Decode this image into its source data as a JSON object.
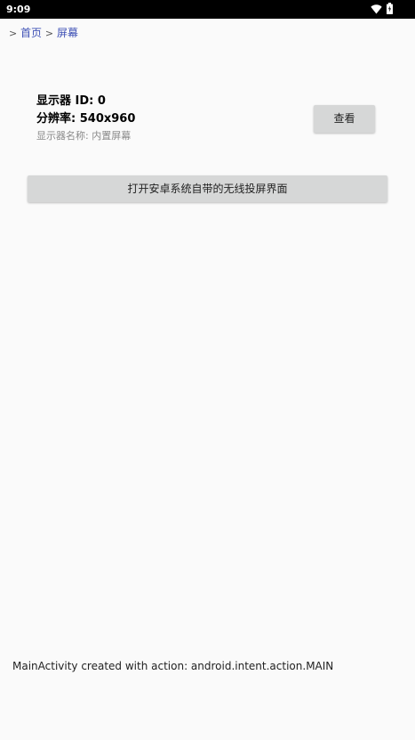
{
  "status_bar": {
    "time": "9:09",
    "icons": [
      "wifi-icon",
      "battery-icon"
    ]
  },
  "breadcrumb": {
    "separator": ">",
    "items": [
      {
        "label": "首页"
      },
      {
        "label": "屏幕"
      }
    ]
  },
  "display": {
    "id_line": "显示器 ID: 0",
    "resolution_line": "分辨率: 540x960",
    "name_line": "显示器名称: 内置屏幕",
    "view_button_label": "查看"
  },
  "cast_button_label": "打开安卓系统自带的无线投屏界面",
  "log_message": "MainActivity created with action: android.intent.action.MAIN",
  "colors": {
    "status_bar_bg": "#000000",
    "background": "#fafafa",
    "link": "#3f51b5",
    "button_bg": "#d6d7d7",
    "secondary_text": "#8a8a8a"
  }
}
